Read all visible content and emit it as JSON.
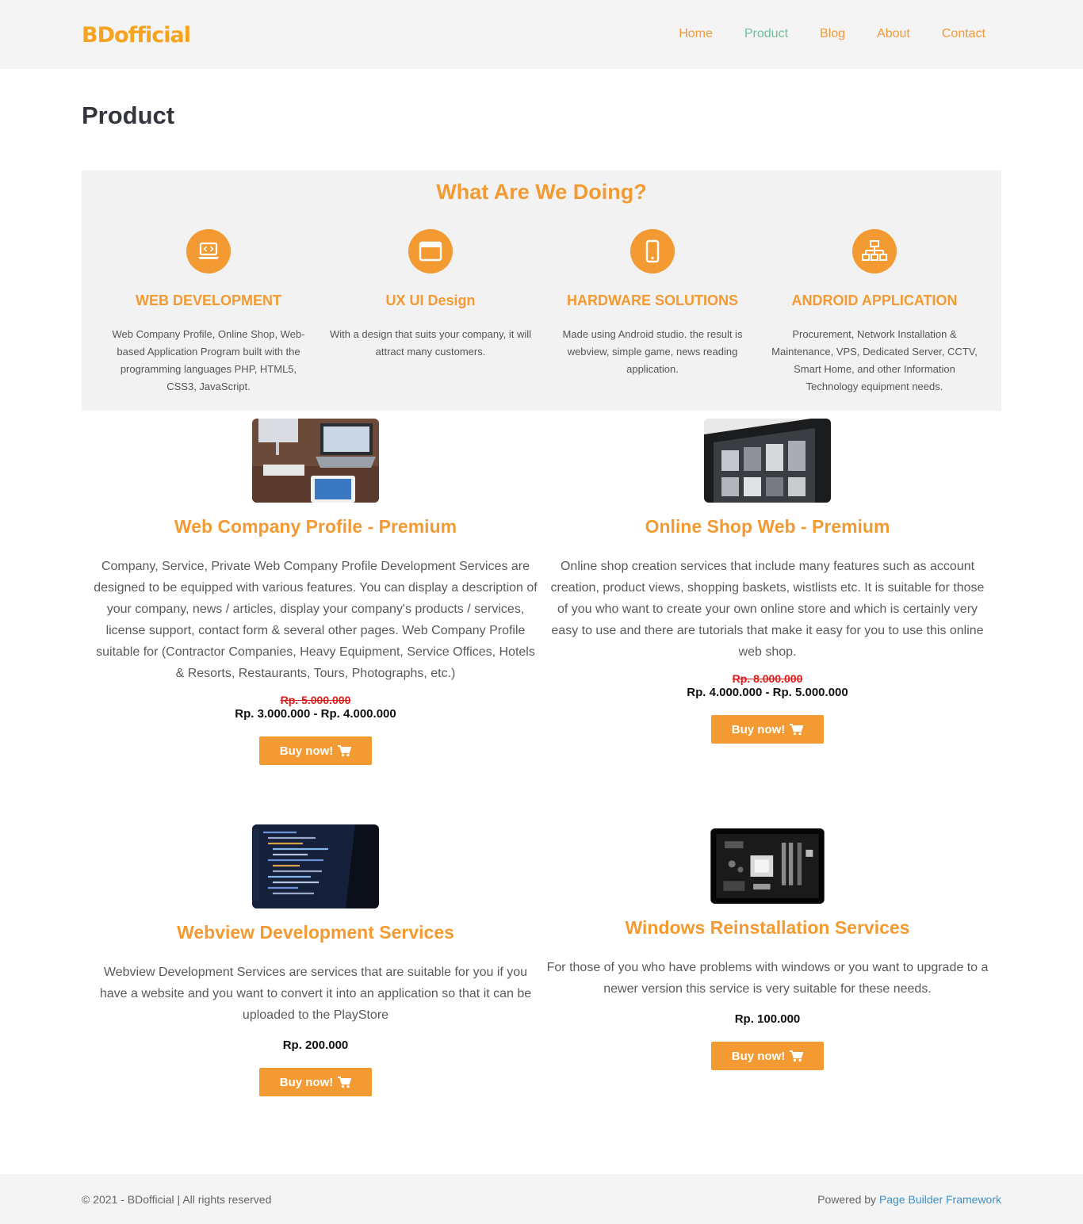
{
  "header": {
    "logo": "BDofficial",
    "nav": [
      {
        "label": "Home"
      },
      {
        "label": "Product",
        "active": true
      },
      {
        "label": "Blog"
      },
      {
        "label": "About"
      },
      {
        "label": "Contact"
      }
    ]
  },
  "page_title": "Product",
  "services": {
    "heading": "What Are We Doing?",
    "items": [
      {
        "icon": "laptop-code-icon",
        "title": "WEB DEVELOPMENT",
        "text": "Web Company Profile, Online Shop, Web-based Application Program built with the programming languages PHP, HTML5, CSS3, JavaScript."
      },
      {
        "icon": "browser-window-icon",
        "title": "UX UI Design",
        "text": "With a design that suits your company, it will attract many customers."
      },
      {
        "icon": "mobile-phone-icon",
        "title": "HARDWARE SOLUTIONS",
        "text": "Made using Android studio. the result is webview, simple game, news reading application."
      },
      {
        "icon": "network-icon",
        "title": "ANDROID APPLICATION",
        "text": "Procurement, Network Installation & Maintenance, VPS, Dedicated Server, CCTV, Smart Home, and other Information Technology equipment needs."
      }
    ]
  },
  "products": [
    {
      "title": "Web Company Profile - Premium",
      "description": "Company, Service, Private Web Company Profile Development Services are designed to be equipped with various features. You can display a description of your company, news / articles, display your company's products / services, license support, contact form & several other pages. Web Company Profile suitable for (Contractor Companies, Heavy Equipment, Service Offices, Hotels & Resorts, Restaurants, Tours, Photographs, etc.)",
      "old_price": "Rp. 5.000.000",
      "price": "Rp. 3.000.000 - Rp. 4.000.000",
      "button": "Buy now!"
    },
    {
      "title": "Online Shop Web - Premium",
      "description": "Online shop creation services that include many features such as account creation, product views, shopping baskets, wistlists etc. It is suitable for those of you who want to create your own online store and which is certainly very easy to use and there are tutorials that make it easy for you to use this online web shop.",
      "old_price": "Rp. 8.000.000",
      "price": "Rp. 4.000.000 - Rp. 5.000.000",
      "button": "Buy now!"
    },
    {
      "title": "Webview Development Services",
      "description": "Webview Development Services are services that are suitable for you if you have a website and you want to convert it into an application so that it can be uploaded to the PlayStore",
      "price": "Rp. 200.000",
      "button": "Buy now!"
    },
    {
      "title": "Windows Reinstallation Services",
      "description": "For those of you who have problems with windows or you want to upgrade to a newer version this service is very suitable for these needs.",
      "price": "Rp. 100.000",
      "button": "Buy now!"
    }
  ],
  "footer": {
    "copyright": "© 2021 - BDofficial | All rights reserved",
    "powered_prefix": "Powered by ",
    "powered_link": "Page Builder Framework"
  },
  "colors": {
    "accent": "#f39a32",
    "nav_active": "#6fbf9a",
    "strike": "#e01a1a",
    "link": "#3f8ec5"
  }
}
